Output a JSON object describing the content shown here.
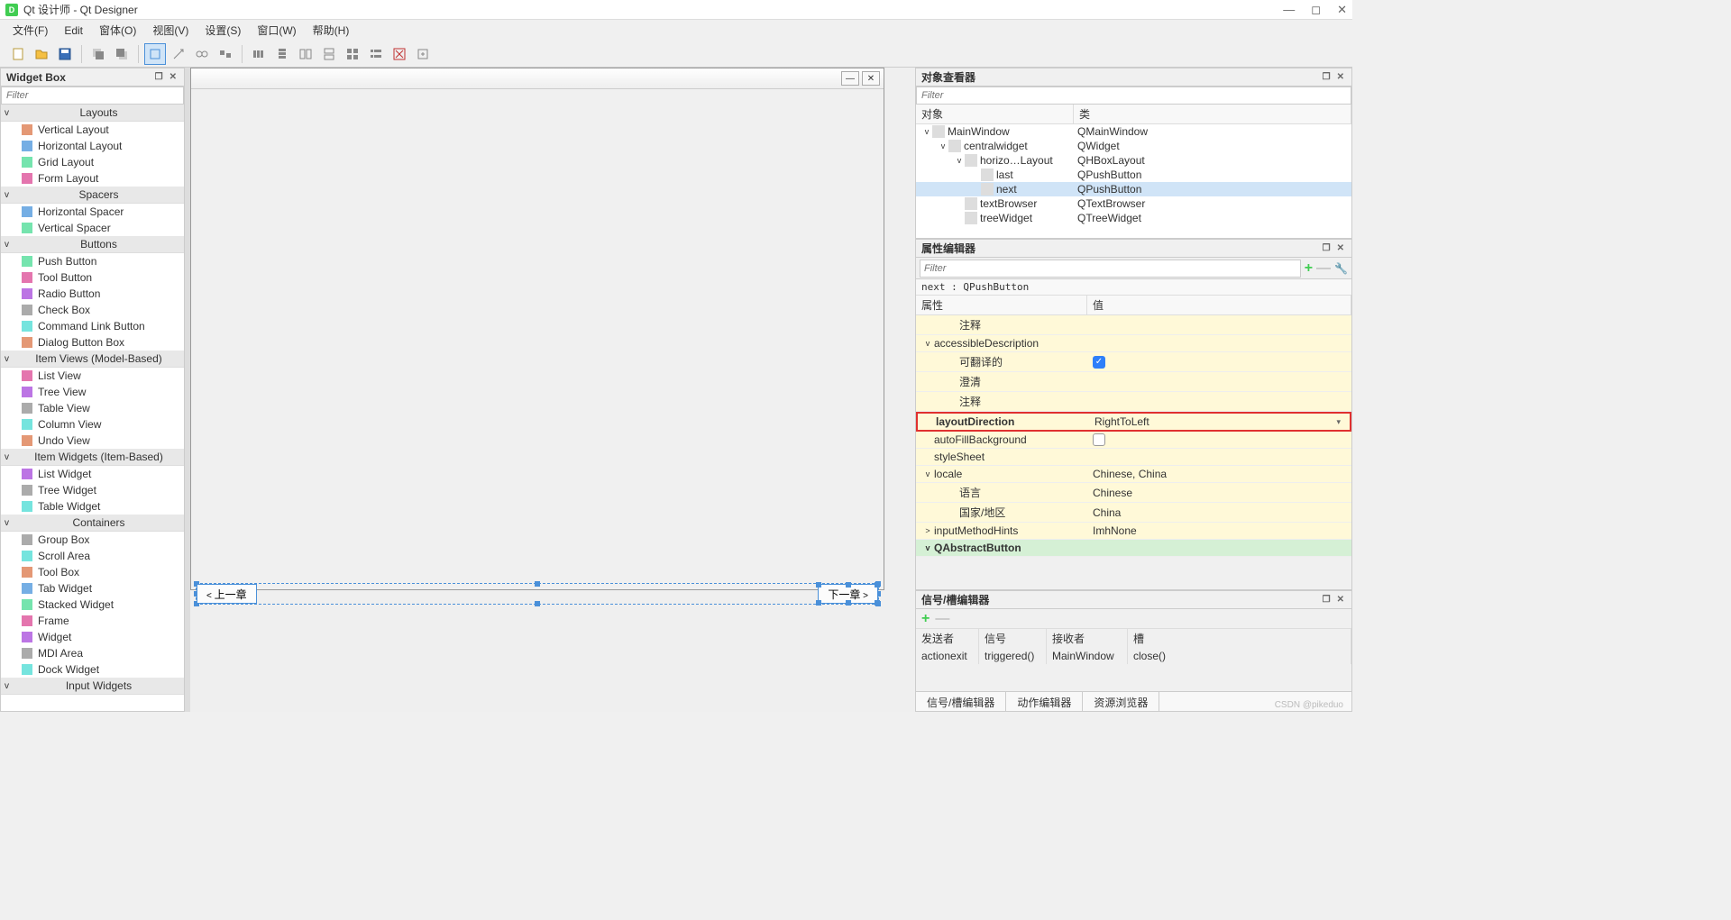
{
  "app": {
    "title": "Qt 设计师 - Qt Designer",
    "icon_letter": "D"
  },
  "menu": [
    "文件(F)",
    "Edit",
    "窗体(O)",
    "视图(V)",
    "设置(S)",
    "窗口(W)",
    "帮助(H)"
  ],
  "widgetbox": {
    "title": "Widget Box",
    "filter_placeholder": "Filter",
    "categories": [
      {
        "label": "Layouts",
        "items": [
          "Vertical Layout",
          "Horizontal Layout",
          "Grid Layout",
          "Form Layout"
        ]
      },
      {
        "label": "Spacers",
        "items": [
          "Horizontal Spacer",
          "Vertical Spacer"
        ]
      },
      {
        "label": "Buttons",
        "items": [
          "Push Button",
          "Tool Button",
          "Radio Button",
          "Check Box",
          "Command Link Button",
          "Dialog Button Box"
        ]
      },
      {
        "label": "Item Views (Model-Based)",
        "items": [
          "List View",
          "Tree View",
          "Table View",
          "Column View",
          "Undo View"
        ]
      },
      {
        "label": "Item Widgets (Item-Based)",
        "items": [
          "List Widget",
          "Tree Widget",
          "Table Widget"
        ]
      },
      {
        "label": "Containers",
        "items": [
          "Group Box",
          "Scroll Area",
          "Tool Box",
          "Tab Widget",
          "Stacked Widget",
          "Frame",
          "Widget",
          "MDI Area",
          "Dock Widget"
        ]
      },
      {
        "label": "Input Widgets",
        "items": []
      }
    ]
  },
  "canvas": {
    "prev_btn": "上一章",
    "next_btn": "下一章"
  },
  "object_inspector": {
    "title": "对象查看器",
    "filter_placeholder": "Filter",
    "headers": [
      "对象",
      "类"
    ],
    "rows": [
      {
        "indent": 0,
        "name": "MainWindow",
        "cls": "QMainWindow",
        "exp": "v"
      },
      {
        "indent": 1,
        "name": "centralwidget",
        "cls": "QWidget",
        "exp": "v"
      },
      {
        "indent": 2,
        "name": "horizo…Layout",
        "cls": "QHBoxLayout",
        "exp": "v"
      },
      {
        "indent": 3,
        "name": "last",
        "cls": "QPushButton"
      },
      {
        "indent": 3,
        "name": "next",
        "cls": "QPushButton",
        "selected": true
      },
      {
        "indent": 2,
        "name": "textBrowser",
        "cls": "QTextBrowser"
      },
      {
        "indent": 2,
        "name": "treeWidget",
        "cls": "QTreeWidget"
      }
    ]
  },
  "property_editor": {
    "title": "属性编辑器",
    "filter_placeholder": "Filter",
    "object_info": "next : QPushButton",
    "headers": [
      "属性",
      "值"
    ],
    "rows": [
      {
        "indent": 2,
        "name": "注释",
        "val": "",
        "cls": "yellow"
      },
      {
        "indent": 0,
        "name": "accessibleDescription",
        "val": "",
        "cls": "yellow",
        "exp": "v"
      },
      {
        "indent": 2,
        "name": "可翻译的",
        "val": "",
        "cls": "yellow",
        "check": true
      },
      {
        "indent": 2,
        "name": "澄清",
        "val": "",
        "cls": "yellow"
      },
      {
        "indent": 2,
        "name": "注释",
        "val": "",
        "cls": "yellow"
      },
      {
        "indent": 0,
        "name": "layoutDirection",
        "val": "RightToLeft",
        "cls": "yellow",
        "highlighted": true,
        "bold": true,
        "dropdown": true
      },
      {
        "indent": 0,
        "name": "autoFillBackground",
        "val": "",
        "cls": "yellow",
        "check": false
      },
      {
        "indent": 0,
        "name": "styleSheet",
        "val": "",
        "cls": "yellow"
      },
      {
        "indent": 0,
        "name": "locale",
        "val": "Chinese, China",
        "cls": "yellow",
        "exp": "v"
      },
      {
        "indent": 2,
        "name": "语言",
        "val": "Chinese",
        "cls": "yellow"
      },
      {
        "indent": 2,
        "name": "国家/地区",
        "val": "China",
        "cls": "yellow"
      },
      {
        "indent": 0,
        "name": "inputMethodHints",
        "val": "ImhNone",
        "cls": "yellow",
        "exp": ">"
      },
      {
        "indent": 0,
        "name": "QAbstractButton",
        "val": "",
        "cls": "green",
        "exp": "v",
        "bold": true
      }
    ]
  },
  "signal_editor": {
    "title": "信号/槽编辑器",
    "headers": [
      "发送者",
      "信号",
      "接收者",
      "槽"
    ],
    "row": [
      "actionexit",
      "triggered()",
      "MainWindow",
      "close()"
    ]
  },
  "bottom_tabs": [
    "信号/槽编辑器",
    "动作编辑器",
    "资源浏览器"
  ],
  "watermark": "CSDN @pikeduo"
}
